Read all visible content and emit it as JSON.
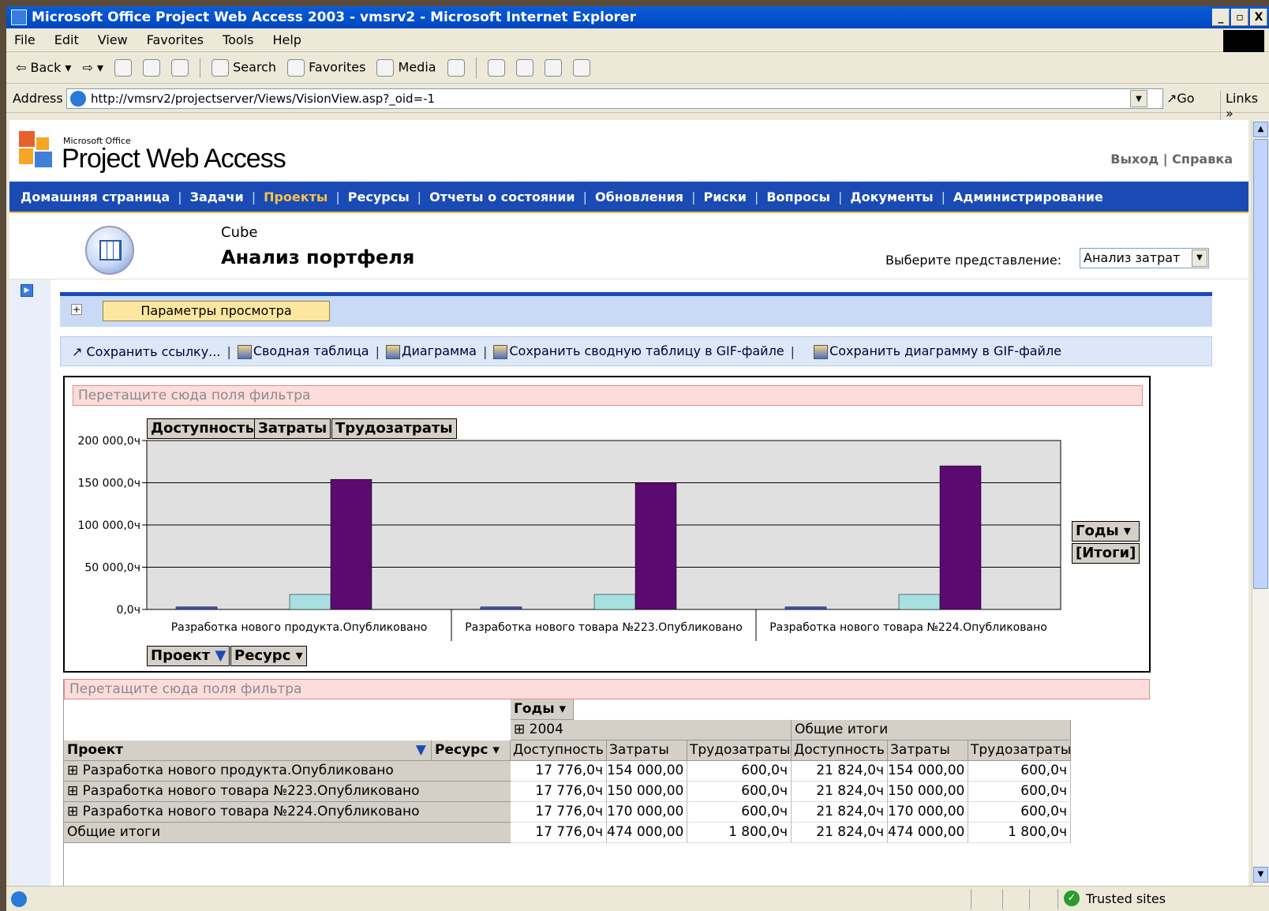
{
  "window": {
    "title": "Microsoft Office Project Web Access 2003 - vmsrv2 - Microsoft Internet Explorer",
    "controls": [
      "_",
      "▫",
      "X"
    ]
  },
  "menu": [
    "File",
    "Edit",
    "View",
    "Favorites",
    "Tools",
    "Help"
  ],
  "toolbar": {
    "back": "Back",
    "search": "Search",
    "favorites": "Favorites",
    "media": "Media"
  },
  "address": {
    "label": "Address",
    "url": "http://vmsrv2/projectserver/Views/VisionView.asp?_oid=-1",
    "go": "Go",
    "links": "Links"
  },
  "pwa": {
    "brand_small": "Microsoft Office",
    "brand": "Project Web Access",
    "top_links": [
      "Выход",
      "Справка"
    ],
    "nav": [
      "Домашняя страница",
      "Задачи",
      "Проекты",
      "Ресурсы",
      "Отчеты о состоянии",
      "Обновления",
      "Риски",
      "Вопросы",
      "Документы",
      "Администрирование"
    ],
    "active_nav": "Проекты",
    "page_subtitle": "Cube",
    "page_title": "Анализ портфеля",
    "view_label": "Выберите представление:",
    "view_selected": "Анализ затрат",
    "params_button": "Параметры просмотра",
    "actions": [
      "Сохранить ссылку...",
      "Сводная таблица",
      "Диаграмма",
      "Сохранить сводную таблицу в GIF-файле",
      "Сохранить диаграмму в GIF-файле"
    ]
  },
  "chart_panel": {
    "filter_zone": "Перетащите сюда поля фильтра",
    "data_fields": [
      "Доступность",
      "Затраты",
      "Трудозатраты"
    ],
    "series_fields": [
      "Годы ▾",
      "[Итоги]"
    ],
    "category_fields": [
      "Проект",
      "Ресурс ▾"
    ]
  },
  "chart_data": {
    "type": "bar",
    "categories": [
      "Разработка нового продукта.Опубликовано",
      "Разработка нового товара №223.Опубликовано",
      "Разработка нового товара №224.Опубликовано"
    ],
    "series": [
      {
        "name": "Доступность",
        "values": [
          3000,
          3000,
          3000
        ],
        "color": "#3b4fb8"
      },
      {
        "name": "Трудозатраты",
        "values": [
          17776,
          17776,
          17776
        ],
        "color": "#a6e0e0"
      },
      {
        "name": "Затраты",
        "values": [
          154000,
          150000,
          170000
        ],
        "color": "#5a0a70"
      }
    ],
    "yticks": [
      "0,0ч",
      "50 000,0ч",
      "100 000,0ч",
      "150 000,0ч",
      "200 000,0ч"
    ],
    "ylim": [
      0,
      200000
    ]
  },
  "pivot": {
    "filter_zone": "Перетащите сюда поля фильтра",
    "col_field": "Годы ▾",
    "year": "⊞ 2004",
    "grand_total_col": "Общие итоги",
    "row_field_project": "Проект",
    "row_field_resource": "Ресурс ▾",
    "measure_headers": [
      "Доступность",
      "Затраты",
      "Трудозатраты",
      "Доступность",
      "Затраты",
      "Трудозатраты"
    ],
    "rows": [
      {
        "label": "⊞ Разработка нового продукта.Опубликовано",
        "values": [
          "17 776,0ч",
          "154 000,00",
          "600,0ч",
          "21 824,0ч",
          "154 000,00",
          "600,0ч"
        ]
      },
      {
        "label": "⊞ Разработка нового товара №223.Опубликовано",
        "values": [
          "17 776,0ч",
          "150 000,00",
          "600,0ч",
          "21 824,0ч",
          "150 000,00",
          "600,0ч"
        ]
      },
      {
        "label": "⊞ Разработка нового товара №224.Опубликовано",
        "values": [
          "17 776,0ч",
          "170 000,00",
          "600,0ч",
          "21 824,0ч",
          "170 000,00",
          "600,0ч"
        ]
      },
      {
        "label": "Общие итоги",
        "values": [
          "17 776,0ч",
          "474 000,00",
          "1 800,0ч",
          "21 824,0ч",
          "474 000,00",
          "1 800,0ч"
        ]
      }
    ]
  },
  "status": {
    "zone": "Trusted sites"
  }
}
